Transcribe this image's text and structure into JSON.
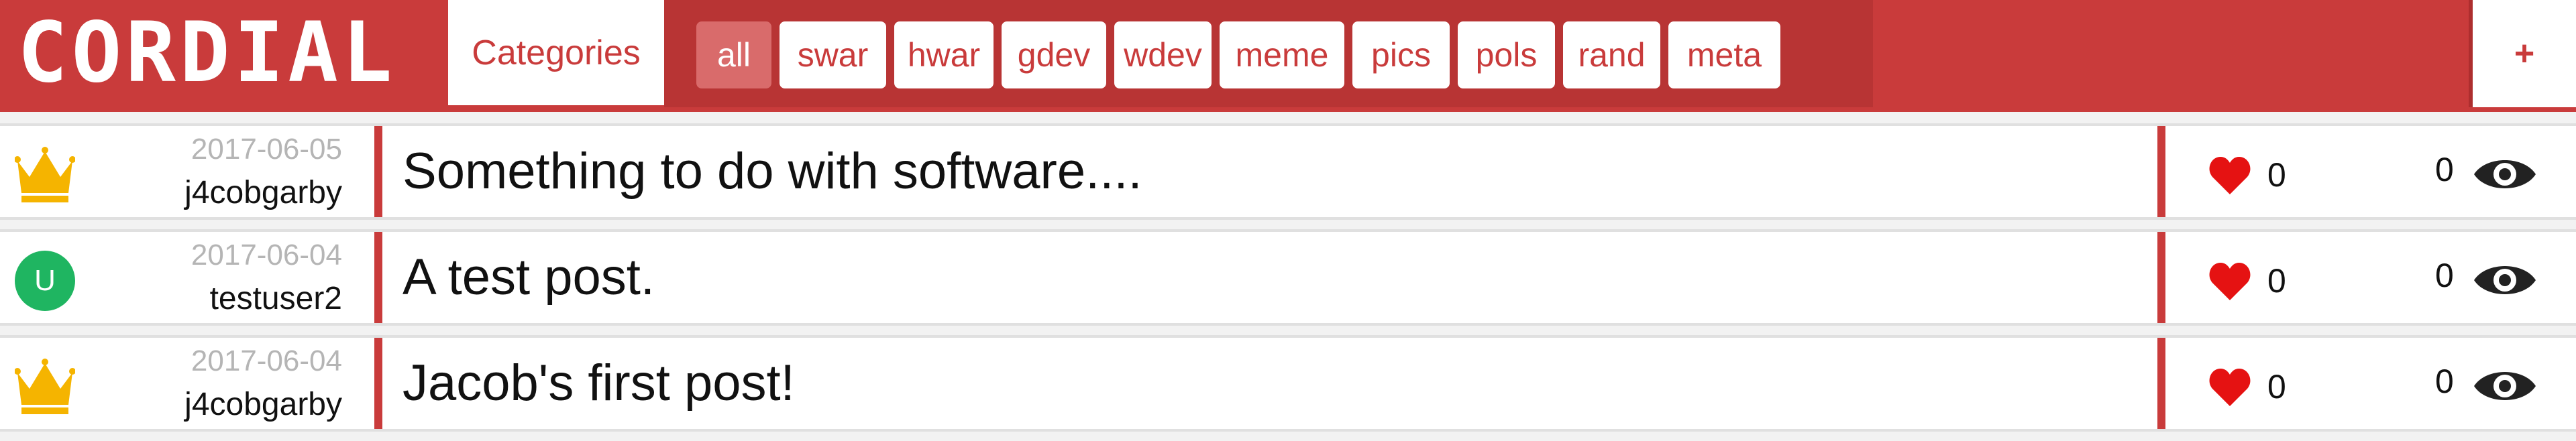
{
  "app": {
    "logo_text": "CORDIAL",
    "categories_label": "Categories",
    "add_label": "+"
  },
  "tags": [
    {
      "label": "all",
      "active": true
    },
    {
      "label": "swar",
      "active": false
    },
    {
      "label": "hwar",
      "active": false
    },
    {
      "label": "gdev",
      "active": false
    },
    {
      "label": "wdev",
      "active": false
    },
    {
      "label": "meme",
      "active": false
    },
    {
      "label": "pics",
      "active": false
    },
    {
      "label": "pols",
      "active": false
    },
    {
      "label": "rand",
      "active": false
    },
    {
      "label": "meta",
      "active": false
    }
  ],
  "posts": [
    {
      "avatar": "crown-icon",
      "avatar_letter": "",
      "date": "2017-06-05",
      "user": "j4cobgarby",
      "title": "Something to do with software....",
      "likes": "0",
      "views": "0"
    },
    {
      "avatar": "user-letter-avatar",
      "avatar_letter": "U",
      "date": "2017-06-04",
      "user": "testuser2",
      "title": "A test post.",
      "likes": "0",
      "views": "0"
    },
    {
      "avatar": "crown-icon",
      "avatar_letter": "",
      "date": "2017-06-04",
      "user": "j4cobgarby",
      "title": "Jacob's first post!",
      "likes": "0",
      "views": "0"
    }
  ],
  "colors": {
    "brand": "#c93b3b",
    "strip": "#b83434",
    "active_tag": "#d96b6b",
    "crown": "#f5b400",
    "avatar_green": "#1fb561",
    "heart": "#e51212",
    "eye": "#222222"
  }
}
